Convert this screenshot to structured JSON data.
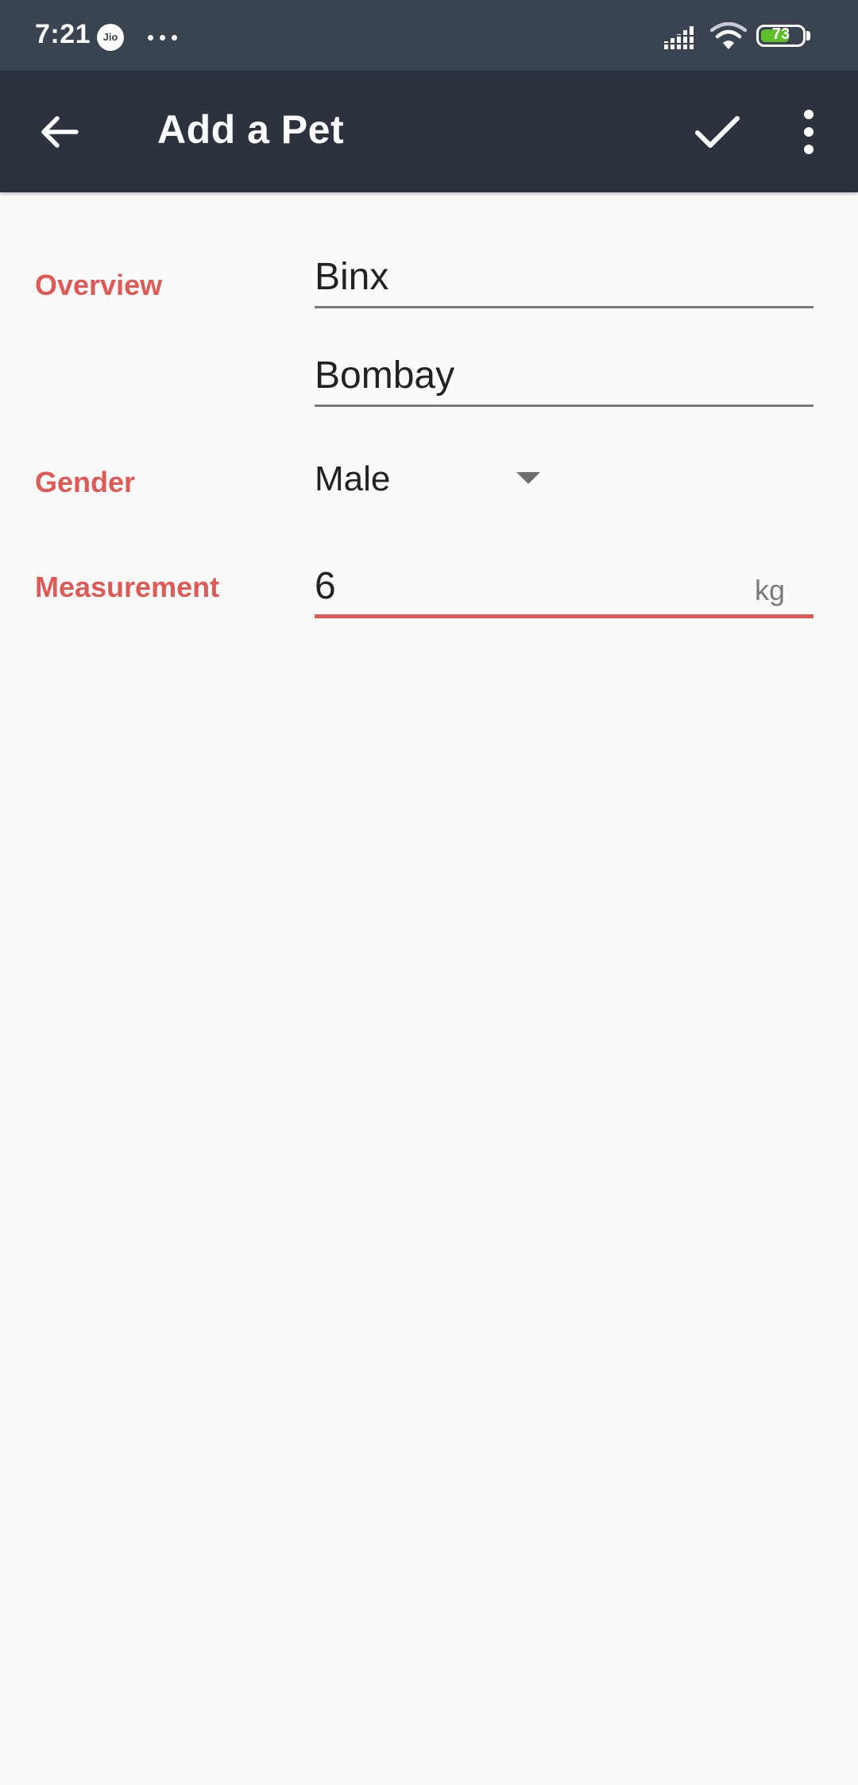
{
  "status_bar": {
    "time": "7:21",
    "carrier_badge": "Jio",
    "battery_level": "73",
    "battery_fraction": 0.73,
    "signal_icon": "signal-icon",
    "wifi_icon": "wifi-icon"
  },
  "app_bar": {
    "title": "Add a Pet",
    "back_icon": "arrow-back-icon",
    "save_icon": "check-icon",
    "more_icon": "more-vert-icon"
  },
  "form": {
    "overview_label": "Overview",
    "name_value": "Binx",
    "breed_value": "Bombay",
    "gender_label": "Gender",
    "gender_value": "Male",
    "measurement_label": "Measurement",
    "measurement_value": "6",
    "measurement_unit": "kg"
  },
  "colors": {
    "status_bar": "#3a4450",
    "app_bar": "#2d333e",
    "accent": "#e05a55",
    "background": "#fafafa",
    "battery_fill": "#5fbf2a"
  }
}
